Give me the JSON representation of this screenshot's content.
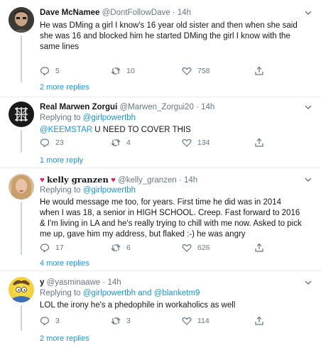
{
  "colors": {
    "link": "#1b95e0",
    "muted": "#657786",
    "text": "#14171a",
    "divider": "#e6ecf0",
    "heart": "#e0245e"
  },
  "tweets": [
    {
      "name": "Dave McNamee",
      "handle": "@DontFollowDave",
      "dot": "·",
      "time": "14h",
      "reply_prefix": "",
      "reply_to": "",
      "reply_and": "",
      "reply_to2": "",
      "text": "He was DMing a girl I know's 16 year old sister and then when she said she was 16 and blocked him he started DMing the girl I know with the same lines",
      "replies": "5",
      "retweets": "10",
      "likes": "758",
      "more": "2 more replies"
    },
    {
      "name": "Real Marwen Zorgui",
      "handle": "@Marwen_Zorgui20",
      "dot": "·",
      "time": "14h",
      "reply_prefix": "Replying to",
      "reply_to": "@girlpowertbh",
      "mention": "@KEEMSTAR",
      "text": " U NEED TO COVER THIS",
      "replies": "23",
      "retweets": "4",
      "likes": "134",
      "more": "1 more reply"
    },
    {
      "name_prefix_icon": "heart-icon",
      "name": "kelly granzen",
      "handle": "@kelly_granzen",
      "dot": "·",
      "time": "14h",
      "reply_prefix": "Replying to",
      "reply_to": "@girlpowertbh",
      "text": "He would message me too, for years. First time he did was in 2014 when I was 18, a senior in HIGH SCHOOL. Creep. Fast forward to 2016 & I'm living in LA and he's really trying to chill with me now. Asked to pick me up, gave him my address, but flaked :-) he was angry",
      "replies": "17",
      "retweets": "6",
      "likes": "626",
      "more": "4 more replies"
    },
    {
      "name": "y",
      "handle": "@yasminaawe",
      "dot": "·",
      "time": "14h",
      "reply_prefix": "Replying to",
      "reply_to": "@girlpowertbh",
      "reply_and": "and",
      "reply_to2": "@blanketm9",
      "text": "LOL the irony he's a phedophile in workaholics as well",
      "replies": "3",
      "retweets": "3",
      "likes": "114",
      "more": "2 more replies"
    }
  ],
  "icons": {
    "reply": "reply-icon",
    "retweet": "retweet-icon",
    "like": "like-icon",
    "share": "share-icon",
    "caret": "chevron-down-icon"
  }
}
